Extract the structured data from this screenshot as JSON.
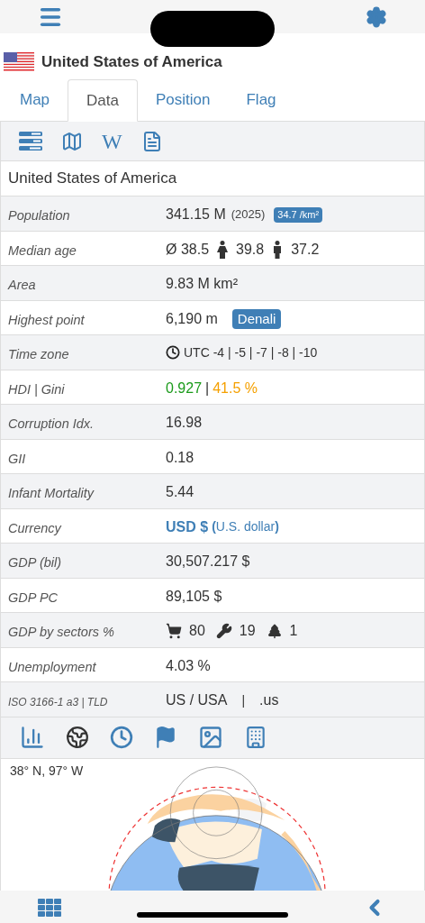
{
  "header": {
    "title": "United States of America"
  },
  "tabs": [
    {
      "label": "Map",
      "selected": false
    },
    {
      "label": "Data",
      "selected": true
    },
    {
      "label": "Position",
      "selected": false
    },
    {
      "label": "Flag",
      "selected": false
    }
  ],
  "toolbar": {
    "wiki_glyph": "W"
  },
  "panel_title": "United States of America",
  "rows": [
    {
      "kind": "population",
      "label": "Population",
      "value": "341.15 M",
      "year": "(2025)",
      "density": "34.7 /km²"
    },
    {
      "kind": "median_age",
      "label": "Median age",
      "average": "Ø 38.5",
      "female": "39.8",
      "male": "37.2"
    },
    {
      "kind": "plain",
      "label": "Area",
      "value": "9.83 M km²"
    },
    {
      "kind": "peak",
      "label": "Highest point",
      "value": "6,190 m",
      "badge": "Denali"
    },
    {
      "kind": "timezone",
      "label": "Time zone",
      "value": "UTC -4 | -5 | -7 | -8 | -10"
    },
    {
      "kind": "hdi_gini",
      "label": "HDI | Gini",
      "hdi": "0.927",
      "separator": "|",
      "gini": "41.5 %"
    },
    {
      "kind": "plain",
      "label": "Corruption Idx.",
      "value": "16.98"
    },
    {
      "kind": "plain",
      "label": "GII",
      "value": "0.18"
    },
    {
      "kind": "plain",
      "label": "Infant Mortality",
      "value": "5.44"
    },
    {
      "kind": "currency",
      "label": "Currency",
      "code": "USD $",
      "name": "**(**U.S. dollar**)**"
    },
    {
      "kind": "plain",
      "label": "GDP (bil)",
      "value": "30,507.217 $"
    },
    {
      "kind": "plain",
      "label": "GDP PC",
      "value": "89,105 $"
    },
    {
      "kind": "sectors",
      "label": "GDP by sectors %",
      "services": "80",
      "industry": "19",
      "agriculture": "1"
    },
    {
      "kind": "plain",
      "label": "Unemployment",
      "value": "4.03 %"
    },
    {
      "kind": "iso",
      "label": "ISO 3166-1 a3 | TLD",
      "code": "US / USA",
      "separator": "|",
      "tld": ".us"
    }
  ],
  "map": {
    "coordinates": "38° N, 97° W"
  }
}
